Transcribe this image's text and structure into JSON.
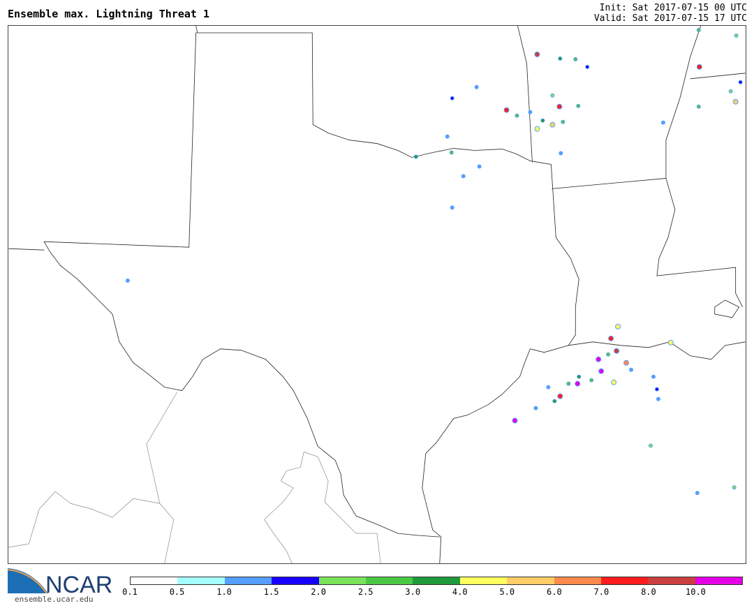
{
  "header": {
    "title": "Ensemble max. Lightning Threat 1",
    "init": "Init: Sat 2017-07-15 00 UTC",
    "valid": "Valid: Sat 2017-07-15 17 UTC"
  },
  "logo": {
    "text": "NCAR",
    "url": "ensemble.ucar.edu"
  },
  "colorbar": {
    "labels": [
      "0.1",
      "0.5",
      "1.0",
      "1.5",
      "2.0",
      "2.5",
      "3.0",
      "4.0",
      "5.0",
      "6.0",
      "7.0",
      "8.0",
      "10.0"
    ],
    "colors": [
      "#ffffff",
      "#a6ffff",
      "#569eff",
      "#1800ff",
      "#7ae35a",
      "#4cc944",
      "#1f9a3c",
      "#ffff5e",
      "#ffcd66",
      "#ff8a4c",
      "#ff1d1d",
      "#cc3f3f",
      "#e600e6"
    ]
  }
}
